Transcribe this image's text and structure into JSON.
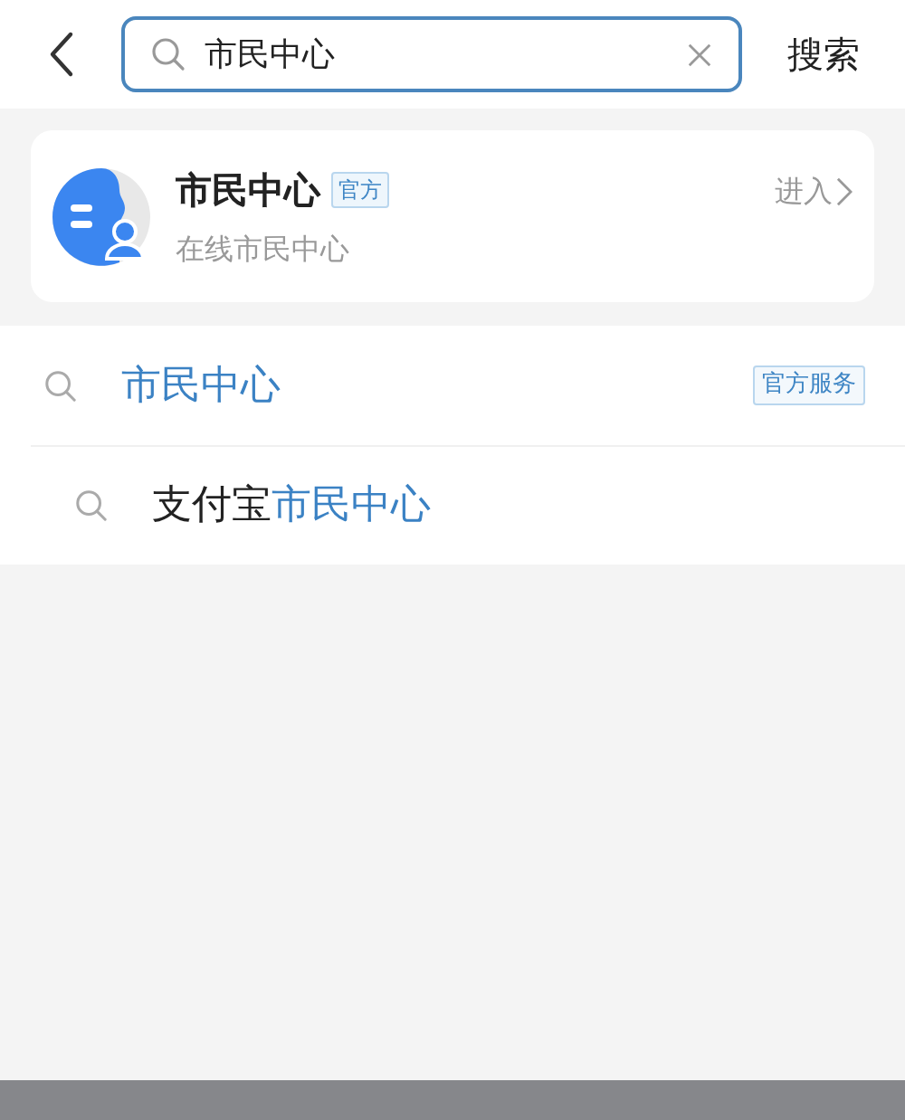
{
  "search": {
    "value": "市民中心",
    "action": "搜索"
  },
  "result": {
    "title": "市民中心",
    "badge": "官方",
    "subtitle": "在线市民中心",
    "action": "进入"
  },
  "suggestions": [
    {
      "match": "市民中心",
      "badge": "官方服务"
    },
    {
      "prefix": "支付宝",
      "match": "市民中心"
    }
  ]
}
